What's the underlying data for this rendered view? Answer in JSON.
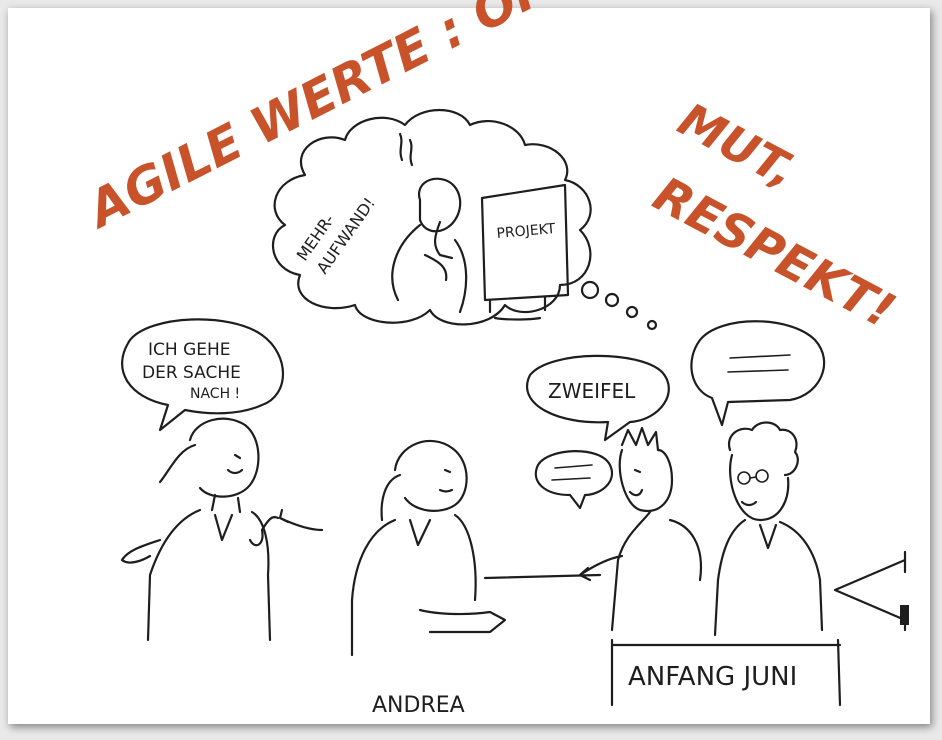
{
  "headline": {
    "line1": "AGILE WERTE : OFFENHEIT,",
    "line2": "MUT,",
    "line3": "RESPEKT!",
    "color": "#c8522a"
  },
  "thought_bubble": {
    "exclamation_line1": "MEHR-",
    "exclamation_line2": "AUFWAND!",
    "monitor_label": "PROJEKT"
  },
  "speech_bubble_left": {
    "line1": "ICH GEHE",
    "line2": "DER SACHE",
    "line3": "NACH !"
  },
  "speech_bubble_doubt": {
    "text": "ZWEIFEL"
  },
  "labels": {
    "person_name": "ANDREA",
    "date_sign": "ANFANG JUNI"
  },
  "ink_color": "#1e1e1e"
}
